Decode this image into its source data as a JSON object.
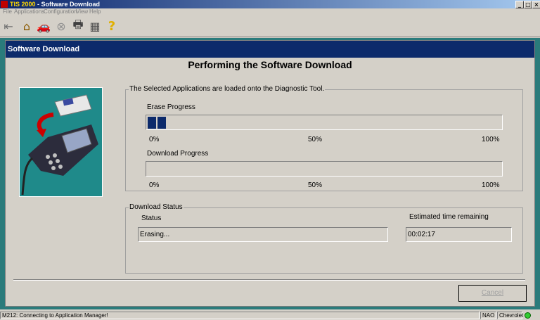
{
  "window": {
    "app_name": "TIS 2000",
    "title_suffix": " - Software Download",
    "min_label": "_",
    "max_label": "□",
    "close_label": "×"
  },
  "menu": [
    "File",
    "Applications",
    "Configuration",
    "View",
    "Help"
  ],
  "toolbar": {
    "exit_glyph": "⇤",
    "home_glyph": "⌂",
    "vehicle_glyph": "🚗",
    "stop_glyph": "⊗",
    "print_glyph": "🖶",
    "tool_glyph": "▦",
    "help_glyph": "?"
  },
  "panel": {
    "header": "Software Download",
    "title": "Performing the Software Download"
  },
  "loaded_group": {
    "legend": "The Selected Applications are loaded onto the Diagnostic Tool.",
    "erase_label": "Erase Progress",
    "erase_progress": 0.06,
    "download_label": "Download Progress",
    "download_progress": 0,
    "scale": [
      "0%",
      "50%",
      "100%"
    ]
  },
  "status_group": {
    "legend": "Download Status",
    "status_label": "Status",
    "status_value": "Erasing...",
    "time_label": "Estimated time remaining",
    "time_value": "00:02:17"
  },
  "buttons": {
    "cancel": "Cancel"
  },
  "statusbar": {
    "message": "M212: Connecting to Application Manager!",
    "region": "NAO",
    "brand": "Chevrolet"
  },
  "colors": {
    "accent": "#0c2a6b",
    "frame": "#2a7b7b"
  }
}
